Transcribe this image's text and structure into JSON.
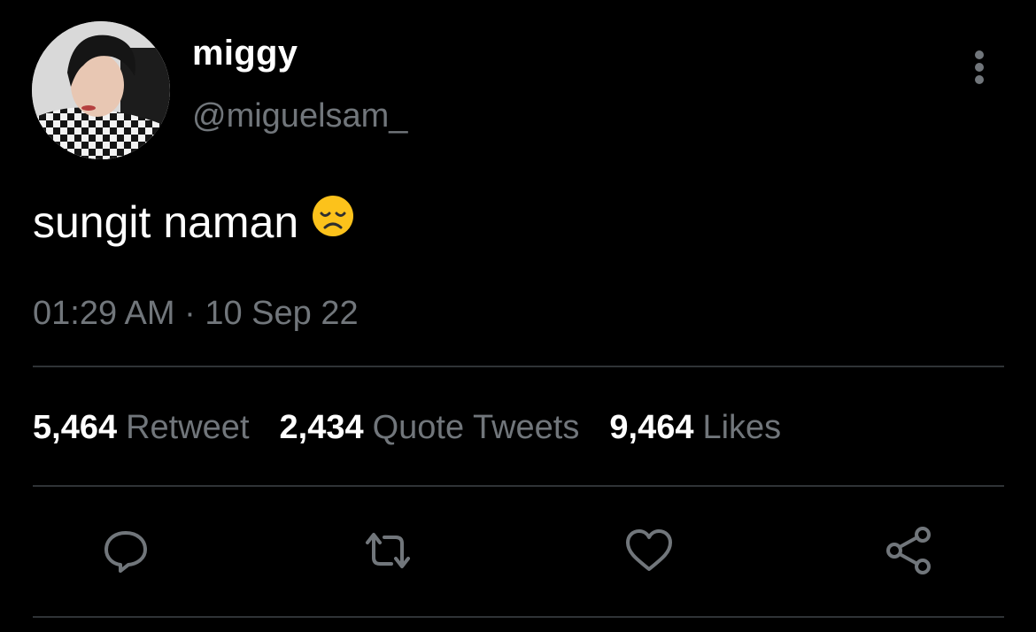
{
  "tweet": {
    "author": {
      "display_name": "miggy",
      "handle": "@miguelsam_"
    },
    "text": "sungit naman",
    "emoji": "disappointed-face",
    "timestamp": "01:29 AM · 10 Sep 22",
    "stats": [
      {
        "count": "5,464",
        "label": "Retweet"
      },
      {
        "count": "2,434",
        "label": "Quote Tweets"
      },
      {
        "count": "9,464",
        "label": "Likes"
      }
    ],
    "actions": [
      "reply-icon",
      "retweet-icon",
      "like-icon",
      "share-icon"
    ]
  },
  "colors": {
    "background": "#000000",
    "primary_text": "#ffffff",
    "secondary_text": "#71767b",
    "divider": "#2f3336",
    "emoji_yellow": "#fcc21b"
  }
}
